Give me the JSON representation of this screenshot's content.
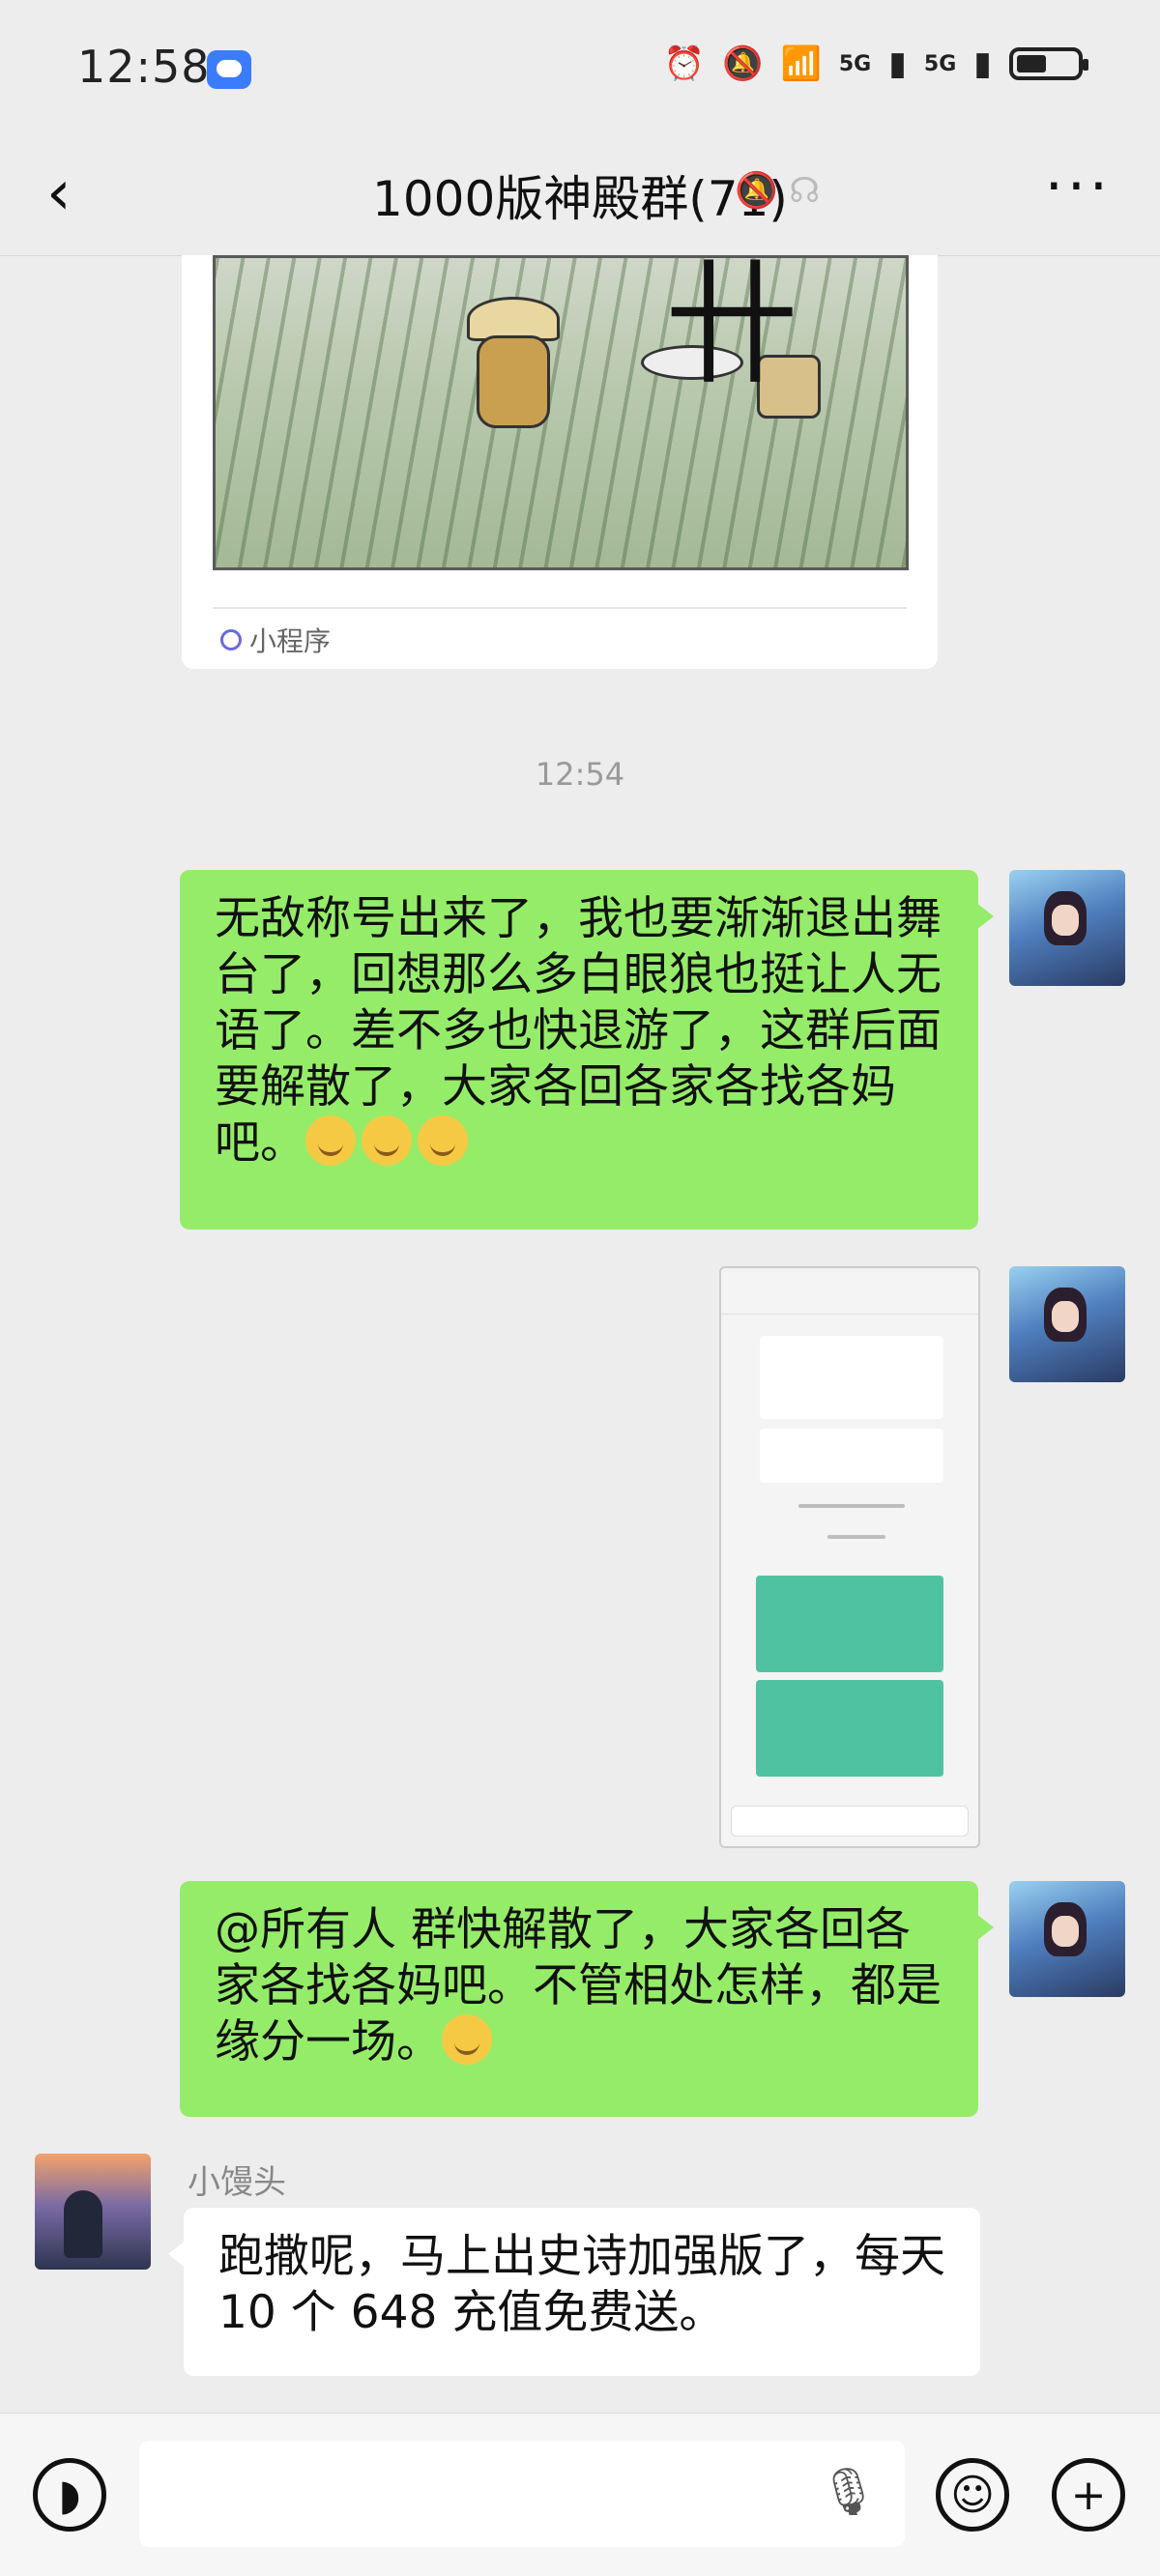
{
  "status_bar": {
    "time": "12:58",
    "signal1": "5G",
    "signal2": "5G"
  },
  "header": {
    "back": "‹",
    "title": "1000版神殿群(71)",
    "more": "···"
  },
  "miniprogram_card": {
    "label": "小程序"
  },
  "timestamp": "12:54",
  "messages": [
    {
      "sender": "me",
      "type": "text",
      "text": "无敌称号出来了，我也要渐渐退出舞台了，回想那么多白眼狼也挺让人无语了。差不多也快退游了，这群后面要解散了，大家各回各家各找各妈吧。",
      "emoji_count": 3
    },
    {
      "sender": "me",
      "type": "image",
      "caption": ""
    },
    {
      "sender": "me",
      "type": "text",
      "text": "@所有人  群快解散了，大家各回各家各找各妈吧。不管相处怎样，都是缘分一场。",
      "emoji_count": 1
    },
    {
      "sender": "小馒头",
      "type": "text",
      "text": "跑撒呢，马上出史诗加强版了，每天 10 个 648 充值免费送。",
      "emoji_count": 0
    }
  ],
  "input_bar": {
    "voice_icon": "voice-icon",
    "mic_icon": "mic-icon",
    "emoji_icon": "emoji-icon",
    "plus_icon": "plus-icon"
  },
  "colors": {
    "my_bubble": "#95ec69",
    "other_bubble": "#ffffff",
    "background": "#ededed"
  }
}
